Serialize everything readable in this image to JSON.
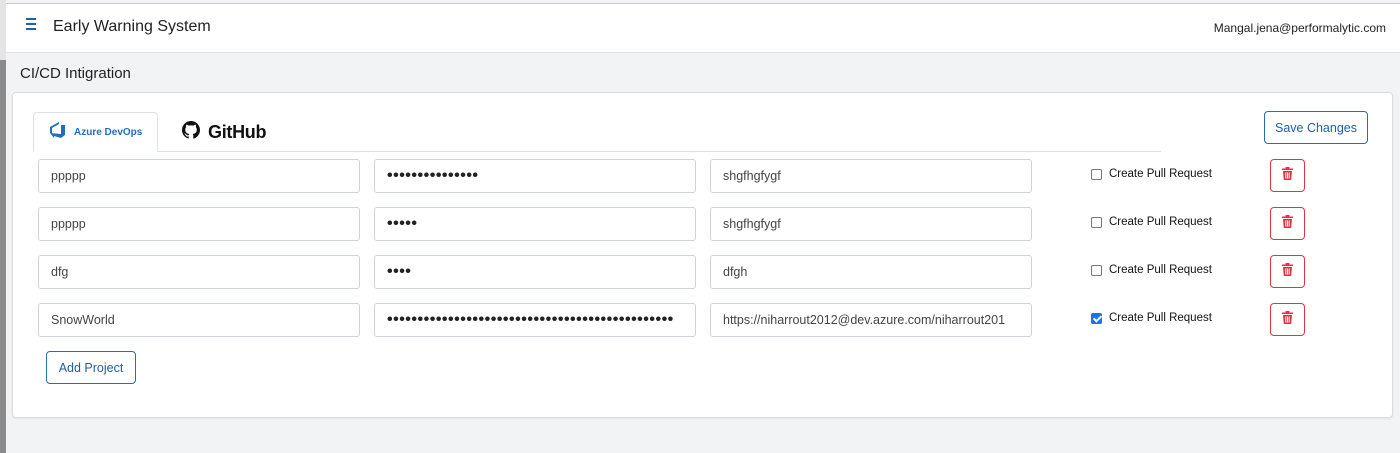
{
  "header": {
    "app_title": "Early Warning System",
    "user_email": "Mangal.jena@performalytic.com"
  },
  "page": {
    "title": "CI/CD Intigration"
  },
  "tabs": [
    {
      "label": "Azure DevOps",
      "icon": "azure-devops-icon",
      "active": true
    },
    {
      "label": "GitHub",
      "icon": "github-icon",
      "active": false
    }
  ],
  "actions": {
    "save_label": "Save Changes",
    "add_label": "Add Project"
  },
  "projects": [
    {
      "name": "ppppp",
      "token": "•••••••••••••••",
      "url": "shgfhgfygf",
      "create_pr_label": "Create Pull Request",
      "create_pr": false
    },
    {
      "name": "ppppp",
      "token": "•••••",
      "url": "shgfhgfygf",
      "create_pr_label": "Create Pull Request",
      "create_pr": false
    },
    {
      "name": "dfg",
      "token": "••••",
      "url": "dfgh",
      "create_pr_label": "Create Pull Request",
      "create_pr": false
    },
    {
      "name": "SnowWorld",
      "token": "•••••••••••••••••••••••••••••••••••••••••••••••",
      "url": "https://niharrout2012@dev.azure.com/niharrout201",
      "create_pr_label": "Create Pull Request",
      "create_pr": true
    }
  ],
  "colors": {
    "primary": "#1f5fa8",
    "danger": "#dc3545",
    "checkbox_on": "#1a73e8"
  }
}
